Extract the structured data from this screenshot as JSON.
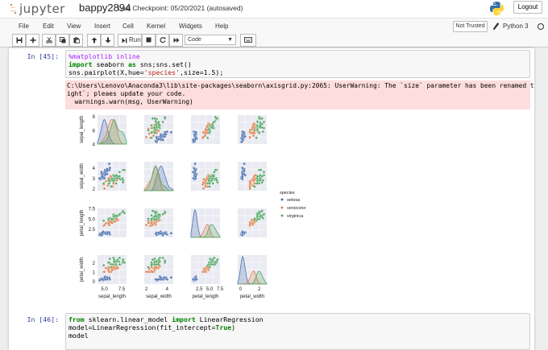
{
  "header": {
    "logo_text": "jupyter",
    "notebook_name": "bappy2894",
    "checkpoint": "Last Checkpoint: 05/20/2021  (autosaved)",
    "logout_label": "Logout"
  },
  "menu": {
    "items": [
      "File",
      "Edit",
      "View",
      "Insert",
      "Cell",
      "Kernel",
      "Widgets",
      "Help"
    ],
    "trusted_label": "Not Trusted",
    "kernel_name": "Python 3"
  },
  "toolbar": {
    "run_label": "Run",
    "cell_type": "Code"
  },
  "cells": [
    {
      "prompt": "In [45]:",
      "code_lines": [
        "%matplotlib inline",
        "import seaborn as sns;sns.set()",
        "sns.pairplot(X,hue='species',size=1.5);"
      ],
      "stderr_lines": [
        "C:\\Users\\Lenovo\\Anaconda3\\lib\\site-packages\\seaborn\\axisgrid.py:2065: UserWarning: The `size` parameter has been renamed to `he",
        "ight`; pleaes update your code.",
        "  warnings.warn(msg, UserWarning)"
      ]
    },
    {
      "prompt": "In [46]:",
      "code_lines": [
        "from sklearn.linear_model import LinearRegression",
        "model=LinearRegression(fit_intercept=True)",
        "model"
      ]
    }
  ],
  "chart_data": {
    "type": "scatter",
    "variables": [
      "sepal_length",
      "sepal_width",
      "petal_length",
      "petal_width"
    ],
    "ytick_labels": [
      [
        "4",
        "6",
        "8"
      ],
      [
        "2",
        "3",
        "4"
      ],
      [
        "2.5",
        "5.0",
        "7.5"
      ],
      [
        "0",
        "1",
        "2"
      ]
    ],
    "xtick_labels": [
      [
        "5.0",
        "7.5"
      ],
      [
        "2",
        "4"
      ],
      [
        "2.5",
        "5.0",
        "7.5"
      ],
      [
        "0",
        "2"
      ]
    ],
    "legend": {
      "title": "species",
      "entries": [
        "setosa",
        "versicolor",
        "virginica"
      ],
      "placement": "right"
    },
    "colors": {
      "setosa": "#4c72b0",
      "versicolor": "#dd8452",
      "virginica": "#55a868",
      "panel_bg": "#eaeaf2"
    },
    "ranges": {
      "sepal_length": [
        4.0,
        8.2
      ],
      "sepal_width": [
        1.8,
        4.6
      ],
      "petal_length": [
        0.5,
        7.5
      ],
      "petal_width": [
        -0.3,
        2.8
      ]
    },
    "grid": true,
    "series": [
      {
        "name": "setosa",
        "sepal_length": [
          5.1,
          4.9,
          4.7,
          4.6,
          5.0,
          5.4,
          4.6,
          5.0,
          4.4,
          4.9,
          5.4,
          4.8,
          4.8,
          4.3,
          5.8,
          5.7,
          5.4,
          5.1,
          5.7,
          5.1,
          5.4,
          5.1,
          4.6,
          5.1,
          4.8,
          5.0,
          5.0,
          5.2,
          5.2,
          4.7
        ],
        "sepal_width": [
          3.5,
          3.0,
          3.2,
          3.1,
          3.6,
          3.9,
          3.4,
          3.4,
          2.9,
          3.1,
          3.7,
          3.4,
          3.0,
          3.0,
          4.0,
          4.4,
          3.9,
          3.5,
          3.8,
          3.8,
          3.4,
          3.7,
          3.6,
          3.3,
          3.4,
          3.0,
          3.4,
          3.5,
          3.4,
          3.2
        ],
        "petal_length": [
          1.4,
          1.4,
          1.3,
          1.5,
          1.4,
          1.7,
          1.4,
          1.5,
          1.4,
          1.5,
          1.5,
          1.6,
          1.4,
          1.1,
          1.2,
          1.5,
          1.3,
          1.4,
          1.7,
          1.5,
          1.7,
          1.5,
          1.0,
          1.7,
          1.9,
          1.6,
          1.6,
          1.5,
          1.4,
          1.6
        ],
        "petal_width": [
          0.2,
          0.2,
          0.2,
          0.2,
          0.2,
          0.4,
          0.3,
          0.2,
          0.2,
          0.1,
          0.2,
          0.2,
          0.1,
          0.1,
          0.2,
          0.4,
          0.4,
          0.3,
          0.3,
          0.3,
          0.2,
          0.4,
          0.2,
          0.5,
          0.2,
          0.2,
          0.4,
          0.2,
          0.2,
          0.2
        ]
      },
      {
        "name": "versicolor",
        "sepal_length": [
          7.0,
          6.4,
          6.9,
          5.5,
          6.5,
          5.7,
          6.3,
          4.9,
          6.6,
          5.2,
          5.0,
          5.9,
          6.0,
          6.1,
          5.6,
          6.7,
          5.6,
          5.8,
          6.2,
          5.6,
          5.9,
          6.1,
          6.3,
          6.1,
          6.4,
          6.6,
          6.8,
          6.7,
          6.0,
          5.7
        ],
        "sepal_width": [
          3.2,
          3.2,
          3.1,
          2.3,
          2.8,
          2.8,
          3.3,
          2.4,
          2.9,
          2.7,
          2.0,
          3.0,
          2.2,
          2.9,
          2.9,
          3.1,
          3.0,
          2.7,
          2.2,
          2.5,
          3.2,
          2.8,
          2.5,
          2.8,
          2.9,
          3.0,
          2.8,
          3.0,
          2.9,
          2.6
        ],
        "petal_length": [
          4.7,
          4.5,
          4.9,
          4.0,
          4.6,
          4.5,
          4.7,
          3.3,
          4.6,
          3.9,
          3.5,
          4.2,
          4.0,
          4.7,
          3.6,
          4.4,
          4.5,
          4.1,
          4.5,
          3.9,
          4.8,
          4.0,
          4.9,
          4.7,
          4.3,
          4.4,
          4.8,
          5.0,
          4.5,
          3.5
        ],
        "petal_width": [
          1.4,
          1.5,
          1.5,
          1.3,
          1.5,
          1.3,
          1.6,
          1.0,
          1.3,
          1.4,
          1.0,
          1.5,
          1.0,
          1.4,
          1.3,
          1.4,
          1.5,
          1.0,
          1.5,
          1.1,
          1.8,
          1.3,
          1.5,
          1.2,
          1.3,
          1.4,
          1.4,
          1.7,
          1.5,
          1.0
        ]
      },
      {
        "name": "virginica",
        "sepal_length": [
          6.3,
          5.8,
          7.1,
          6.3,
          6.5,
          7.6,
          4.9,
          7.3,
          6.7,
          7.2,
          6.5,
          6.4,
          6.8,
          5.7,
          5.8,
          6.4,
          6.5,
          7.7,
          7.7,
          6.0,
          6.9,
          5.6,
          7.7,
          6.3,
          6.7,
          7.2,
          6.2,
          6.1,
          6.4,
          7.9
        ],
        "sepal_width": [
          3.3,
          2.7,
          3.0,
          2.9,
          3.0,
          3.0,
          2.5,
          2.9,
          2.5,
          3.6,
          3.2,
          2.7,
          3.0,
          2.5,
          2.8,
          3.2,
          3.0,
          3.8,
          2.6,
          2.2,
          3.2,
          2.8,
          2.8,
          2.7,
          3.3,
          3.2,
          2.8,
          3.0,
          2.8,
          3.8
        ],
        "petal_length": [
          6.0,
          5.1,
          5.9,
          5.6,
          5.8,
          6.6,
          4.5,
          6.3,
          5.8,
          6.1,
          5.1,
          5.3,
          5.5,
          5.0,
          5.1,
          5.3,
          5.5,
          6.7,
          6.9,
          5.0,
          5.7,
          4.9,
          6.7,
          4.9,
          5.7,
          6.0,
          4.8,
          4.9,
          5.6,
          6.4
        ],
        "petal_width": [
          2.5,
          1.9,
          2.1,
          1.8,
          2.2,
          2.1,
          1.7,
          1.8,
          1.8,
          2.5,
          2.0,
          1.9,
          2.1,
          2.0,
          2.4,
          2.3,
          1.8,
          2.2,
          2.3,
          1.5,
          2.3,
          2.0,
          2.0,
          1.8,
          2.1,
          1.8,
          1.8,
          1.8,
          2.1,
          2.0
        ]
      }
    ]
  }
}
